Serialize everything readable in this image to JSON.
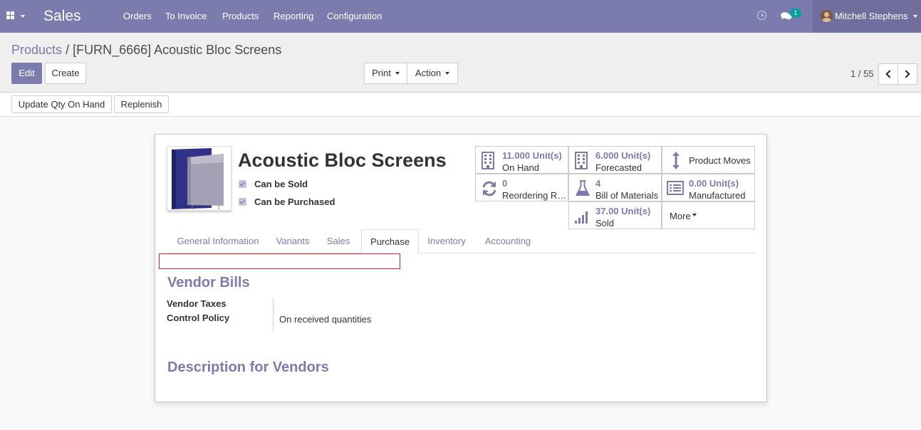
{
  "navbar": {
    "app_name": "Sales",
    "menu": [
      "Orders",
      "To Invoice",
      "Products",
      "Reporting",
      "Configuration"
    ],
    "chat_count": "1",
    "user_name": "Mitchell Stephens",
    "background": "#7c7bad"
  },
  "breadcrumb": {
    "parent": "Products",
    "separator": "/",
    "current": "[FURN_6666] Acoustic Bloc Screens"
  },
  "buttons": {
    "edit": "Edit",
    "create": "Create",
    "print": "Print",
    "action": "Action"
  },
  "pager": {
    "value": "1 / 55"
  },
  "statusbar": {
    "update_qty": "Update Qty On Hand",
    "replenish": "Replenish"
  },
  "product": {
    "name": "Acoustic Bloc Screens",
    "can_be_sold": "Can be Sold",
    "can_be_purchased": "Can be Purchased"
  },
  "smart_buttons": {
    "on_hand_value": "11.000 Unit(s)",
    "on_hand_label": "On Hand",
    "forecasted_value": "6.000 Unit(s)",
    "forecasted_label": "Forecasted",
    "product_moves": "Product Moves",
    "reordering_value": "0",
    "reordering_label": "Reordering R…",
    "bom_value": "4",
    "bom_label": "Bill of Materials",
    "manufactured_value": "0.00 Unit(s)",
    "manufactured_label": "Manufactured",
    "sold_value": "37.00 Unit(s)",
    "sold_label": "Sold",
    "more": "More"
  },
  "tabs": [
    "General Information",
    "Variants",
    "Sales",
    "Purchase",
    "Inventory",
    "Accounting"
  ],
  "active_tab": "Purchase",
  "purchase": {
    "vendor_bills_title": "Vendor Bills",
    "vendor_taxes_label": "Vendor Taxes",
    "control_policy_label": "Control Policy",
    "control_policy_value": "On received quantities",
    "description_title": "Description for Vendors"
  },
  "colors": {
    "accent": "#7c7bad",
    "highlight_border": "#d9262c"
  }
}
